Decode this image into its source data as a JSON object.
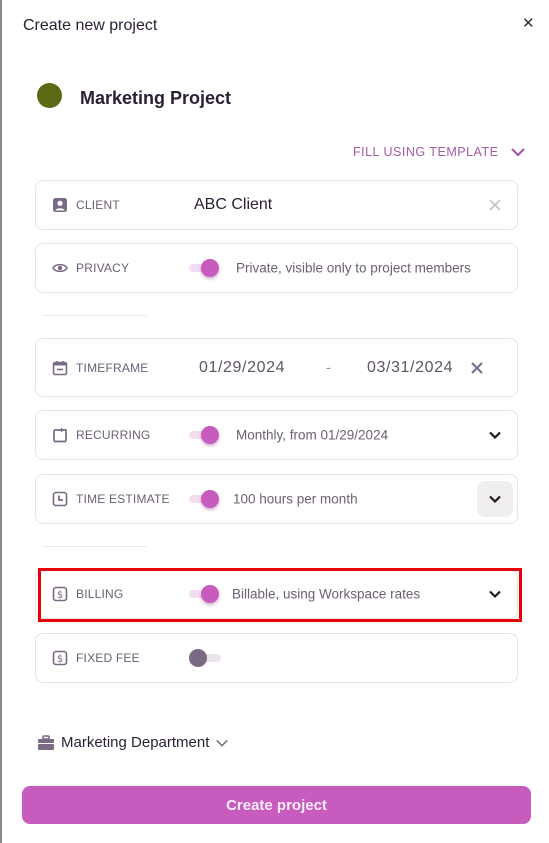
{
  "dialog": {
    "title": "Create new project",
    "close_icon": "close-icon",
    "project_color": "#5a6a14",
    "project_name": "Marketing Project",
    "fill_template_label": "FILL USING TEMPLATE"
  },
  "fields": {
    "client": {
      "label": "CLIENT",
      "value": "ABC Client",
      "icon": "person-icon"
    },
    "privacy": {
      "label": "PRIVACY",
      "enabled": true,
      "value": "Private, visible only to project members",
      "icon": "eye-icon"
    },
    "timeframe": {
      "label": "TIMEFRAME",
      "start": "01/29/2024",
      "separator": "-",
      "end": "03/31/2024",
      "icon": "calendar-icon"
    },
    "recurring": {
      "label": "RECURRING",
      "enabled": true,
      "value": "Monthly, from 01/29/2024",
      "icon": "repeat-icon"
    },
    "time_estimate": {
      "label": "TIME ESTIMATE",
      "enabled": true,
      "value": "100 hours per month",
      "icon": "clock-icon"
    },
    "billing": {
      "label": "BILLING",
      "enabled": true,
      "value": "Billable, using Workspace rates",
      "icon": "dollar-icon"
    },
    "fixed_fee": {
      "label": "FIXED FEE",
      "enabled": false,
      "icon": "dollar-icon"
    }
  },
  "department": {
    "label": "Marketing Department",
    "icon": "briefcase-icon"
  },
  "actions": {
    "create_label": "Create project"
  },
  "colors": {
    "accent": "#c75bbe",
    "highlight": "#e8000b",
    "label": "#6b5f73"
  }
}
